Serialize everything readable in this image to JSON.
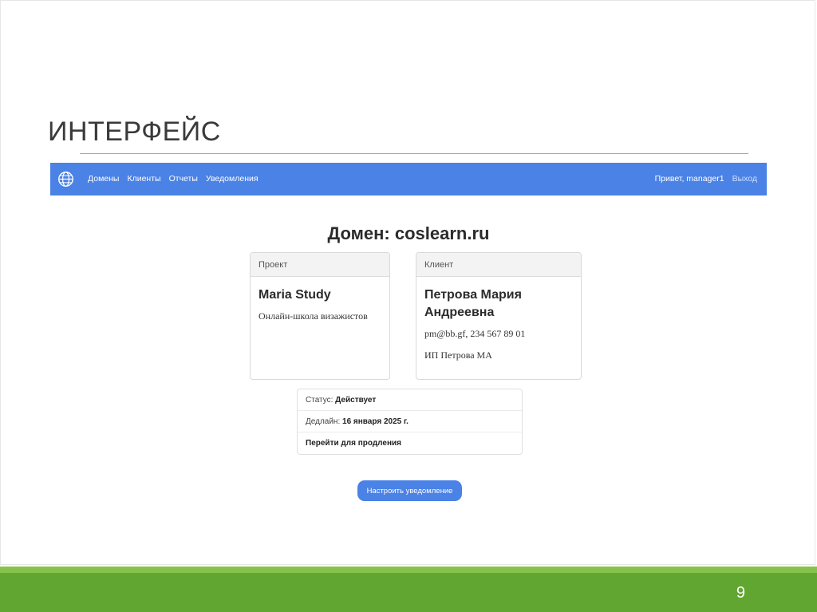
{
  "slide": {
    "title": "ИНТЕРФЕЙС",
    "page_number": "9"
  },
  "navbar": {
    "logo_icon": "globe-icon",
    "links": [
      "Домены",
      "Клиенты",
      "Отчеты",
      "Уведомления"
    ],
    "greeting": "Привет, manager1",
    "logout": "Выход"
  },
  "domain": {
    "title": "Домен: coslearn.ru"
  },
  "project_card": {
    "header": "Проект",
    "name": "Maria Study",
    "description": "Онлайн-школа визажистов"
  },
  "client_card": {
    "header": "Клиент",
    "name": "Петрова Мария Андреевна",
    "contacts": "pm@bb.gf, 234 567 89 01",
    "company": "ИП Петрова МА"
  },
  "status": {
    "status_label": "Статус:",
    "status_value": "Действует",
    "deadline_label": "Дедлайн:",
    "deadline_value": "16 января 2025 г.",
    "renew_link": "Перейти для продления"
  },
  "actions": {
    "notify_button": "Настроить уведомление"
  },
  "colors": {
    "navbar": "#4a82e6",
    "footer": "#62a632",
    "footer_stripe": "#87c34a"
  }
}
